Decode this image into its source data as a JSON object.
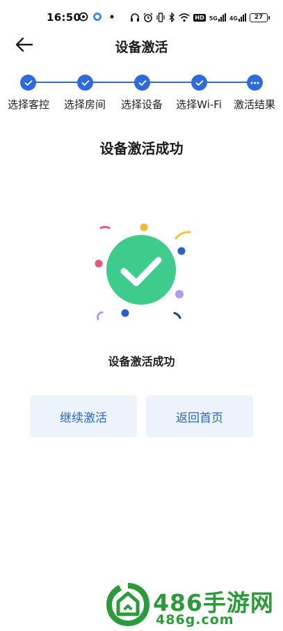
{
  "status_bar": {
    "time": "16:50",
    "battery": "27",
    "signal_1": "5G",
    "signal_2": "4G",
    "network_badge": "HD"
  },
  "header": {
    "title": "设备激活"
  },
  "stepper": {
    "steps": [
      {
        "label": "选择客控",
        "state": "done"
      },
      {
        "label": "选择房间",
        "state": "done"
      },
      {
        "label": "选择设备",
        "state": "done"
      },
      {
        "label": "选择Wi-Fi",
        "state": "done"
      },
      {
        "label": "激活结果",
        "state": "current"
      }
    ]
  },
  "result": {
    "heading": "设备激活成功",
    "caption": "设备激活成功"
  },
  "actions": {
    "continue_label": "继续激活",
    "home_label": "返回首页"
  },
  "watermark": {
    "brand": "486手游网",
    "domain": "486g.com"
  },
  "colors": {
    "accent": "#2f6bd8",
    "success": "#3ecb8b",
    "button_bg": "#edf3fb",
    "watermark": "#2c9a3a"
  }
}
